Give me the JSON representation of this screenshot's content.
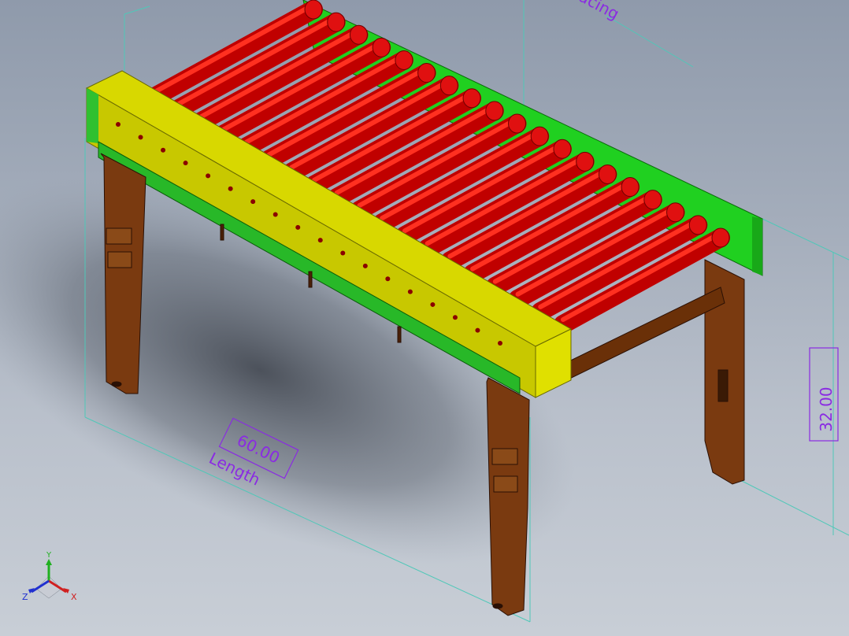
{
  "model": {
    "name": "roller conveyor",
    "colors": {
      "roller": "#d80000",
      "near_side_guard": "#c8c800",
      "far_side_rail": "#20d020",
      "frame": "#7a3a10",
      "dimension": "#8a2be2",
      "extension_line": "#4fc8b8"
    }
  },
  "dimensions": {
    "length": {
      "value": "60.00",
      "label": "Length"
    },
    "height": {
      "value": "32.00"
    },
    "spacing": {
      "label": "acing"
    }
  },
  "triad": {
    "x_label": "X",
    "y_label": "Y",
    "z_label": "Z"
  }
}
